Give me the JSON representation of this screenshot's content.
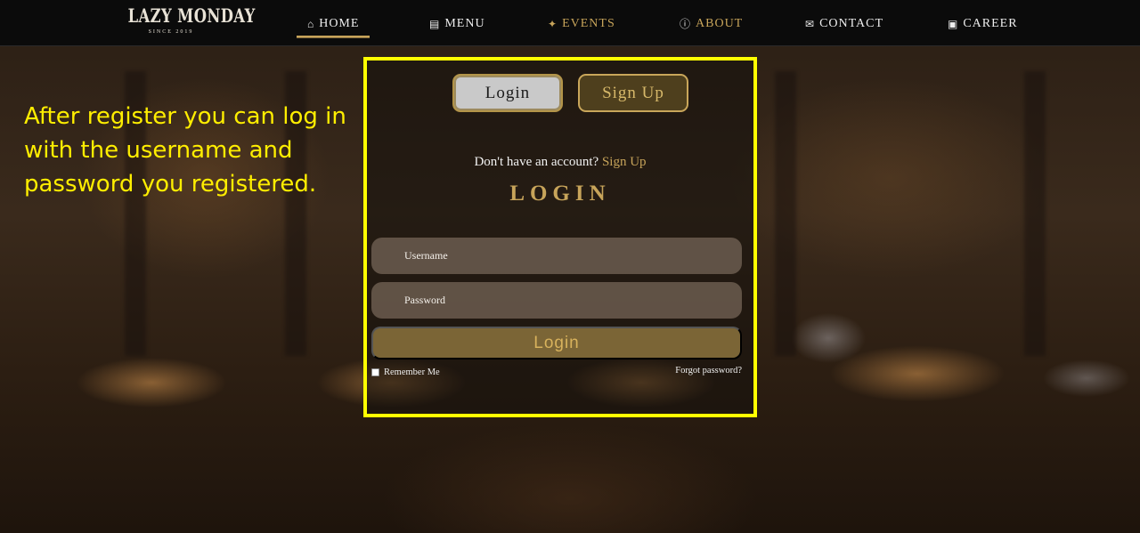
{
  "nav": {
    "logo_title": "LAZY MONDAY",
    "logo_subtitle": "SINCE 2019",
    "items": [
      {
        "label": "HOME",
        "icon": "home-icon",
        "active": true
      },
      {
        "label": "MENU",
        "icon": "menu-clipboard-icon"
      },
      {
        "label": "EVENTS",
        "icon": "party-popper-icon"
      },
      {
        "label": "ABOUT",
        "icon": "info-icon"
      },
      {
        "label": "CONTACT",
        "icon": "chat-icon"
      },
      {
        "label": "CAREER",
        "icon": "briefcase-icon"
      }
    ],
    "colors": {
      "bar": "#0b0b0b",
      "gold": "#c7a45a",
      "text": "#eeeeee"
    }
  },
  "instruction": "After register you can log in with the username and password you registered.",
  "form": {
    "toggle_login": "Login",
    "toggle_signup": "Sign Up",
    "account_prompt": "Don't have an account?",
    "account_link": "Sign Up",
    "heading": "LOGIN",
    "username_placeholder": "Username",
    "password_placeholder": "Password",
    "submit_label": "Login",
    "remember_label": "Remember Me",
    "remember_checked": false,
    "forgot_label": "Forgot password?"
  },
  "colors": {
    "highlight": "#ffff00",
    "instruction_text": "#ffee00",
    "gold": "#c7a45a",
    "submit_bg": "#7b6536"
  }
}
